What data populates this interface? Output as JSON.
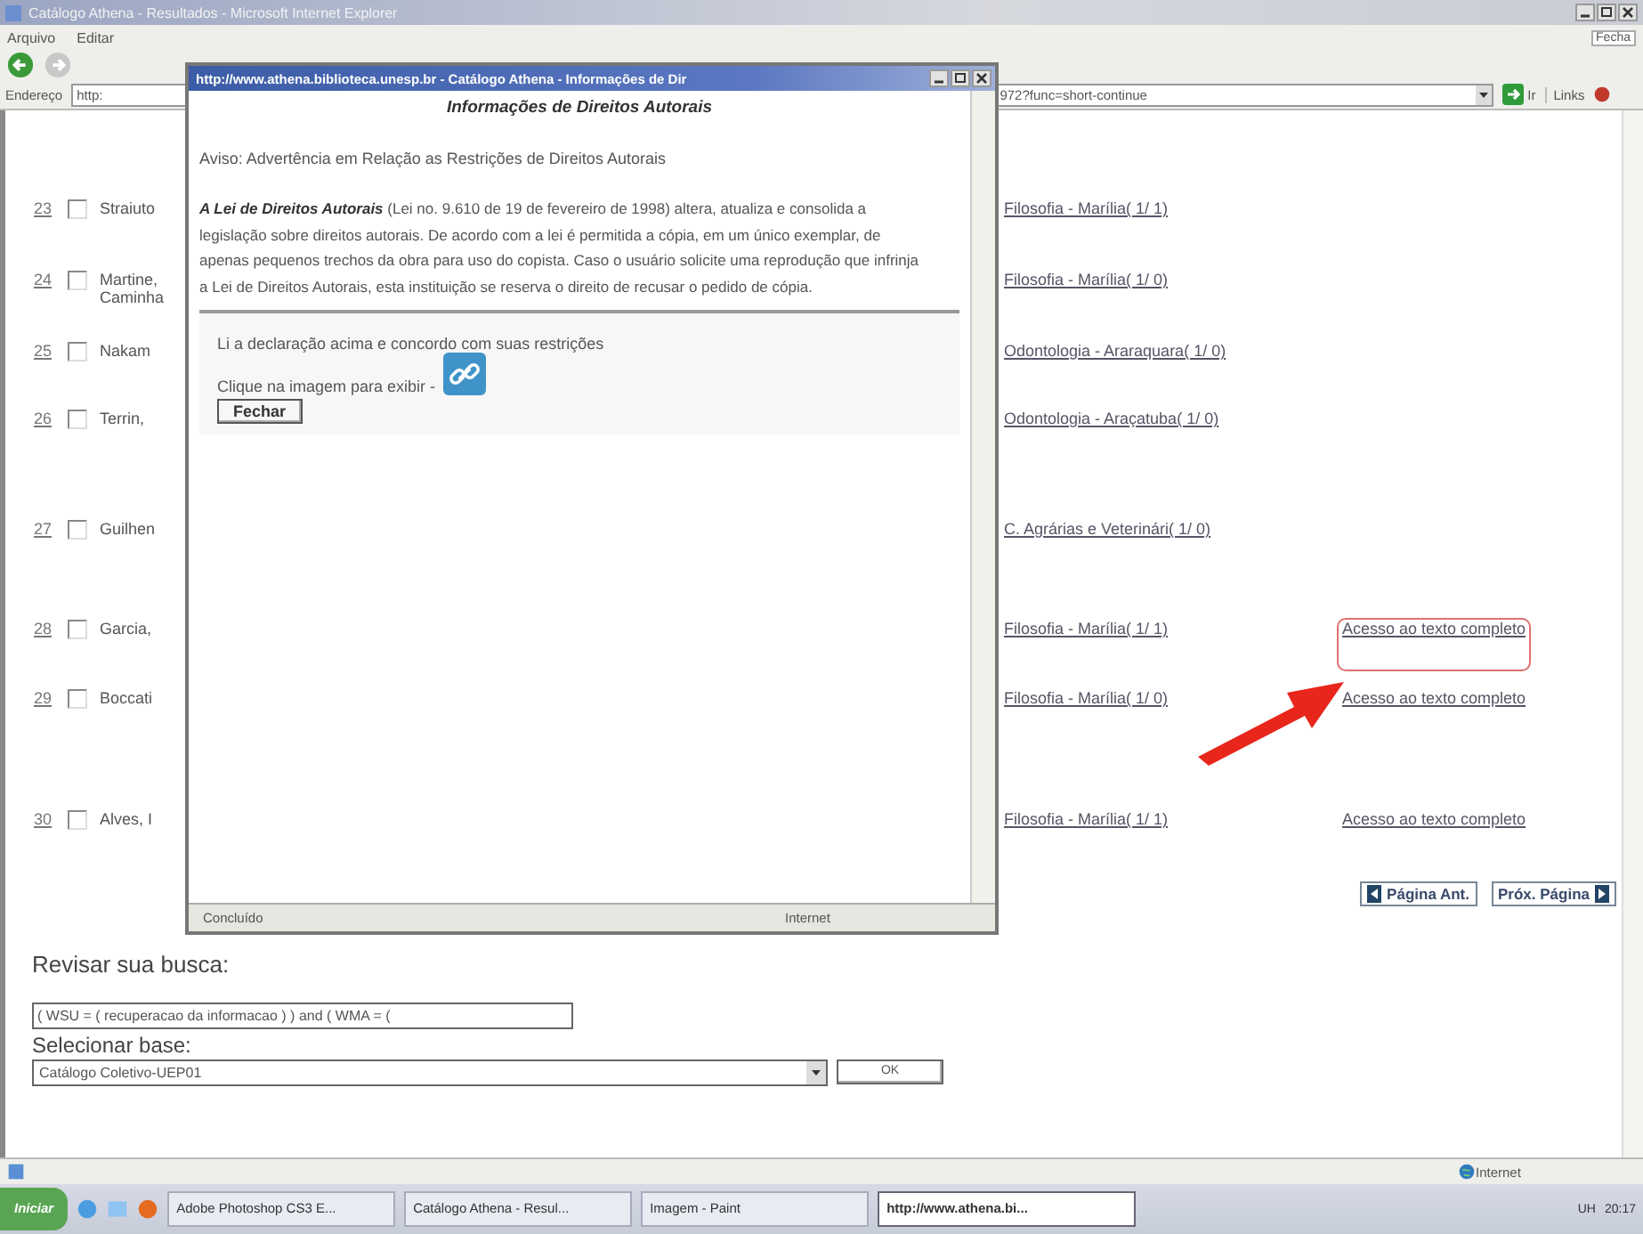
{
  "window": {
    "title": "Catálogo Athena - Resultados - Microsoft Internet Explorer",
    "close_tab": "Fecha"
  },
  "menu": [
    "Arquivo",
    "Editar"
  ],
  "address_bar": {
    "label": "Endereço",
    "prefix": "http:",
    "url": "972?func=short-continue",
    "go": "Ir",
    "links": "Links"
  },
  "results": [
    {
      "number": "23",
      "checked": false,
      "author": [
        "Straiuto"
      ],
      "location": "Filosofia - Marília( 1/ 1)"
    },
    {
      "number": "24",
      "checked": false,
      "author": [
        "Martine,",
        "Caminha"
      ],
      "location": "Filosofia - Marília( 1/ 0)"
    },
    {
      "number": "25",
      "checked": false,
      "author": [
        "Nakam"
      ],
      "location": "Odontologia - Araraquara( 1/ 0)"
    },
    {
      "number": "26",
      "checked": false,
      "author": [
        "Terrin,"
      ],
      "location": "Odontologia - Araçatuba( 1/ 0)"
    },
    {
      "number": "27",
      "checked": false,
      "author": [
        "Guilhen"
      ],
      "location": "C. Agrárias e Veterinári( 1/ 0)"
    },
    {
      "number": "28",
      "checked": false,
      "author": [
        "Garcia,"
      ],
      "location": "Filosofia - Marília( 1/ 1)",
      "full_text": {
        "label": "Acesso ao texto completo",
        "highlighted": true
      }
    },
    {
      "number": "29",
      "checked": false,
      "author": [
        "Boccati"
      ],
      "location": "Filosofia - Marília( 1/ 0)",
      "full_text": {
        "label": "Acesso ao texto completo",
        "highlighted": false
      }
    },
    {
      "number": "30",
      "checked": false,
      "author": [
        "Alves, I"
      ],
      "location": "Filosofia - Marília( 1/ 1)",
      "full_text": {
        "label": "Acesso ao texto completo",
        "highlighted": false
      }
    }
  ],
  "pager": {
    "previous": "Página Ant.",
    "next": "Próx. Página"
  },
  "search": {
    "label": "Revisar sua busca:",
    "value": "( WSU = ( recuperacao da informacao ) ) and ( WMA = ("
  },
  "base": {
    "label": "Selecionar base:",
    "value": "Catálogo Coletivo-UEP01",
    "ok": "OK"
  },
  "status_bar": {
    "zone": "Internet"
  },
  "popup": {
    "title": "http://www.athena.biblioteca.unesp.br - Catálogo Athena - Informações de Dir",
    "heading": "Informações de Direitos Autorais",
    "notice": "Aviso: Advertência em Relação as Restrições de Direitos Autorais",
    "body": "**A Lei de Direitos Autorais** (Lei no. 9.610 de 19 de fevereiro de 1998) altera, atualiza e consolida a legislação sobre direitos autorais. De acordo com a lei é permitida a cópia, em um único exemplar, de apenas pequenos trechos da obra para uso do copista. Caso o usuário solicite uma reprodução que infrinja a Lei de Direitos Autorais, esta instituição se reserva o direito de recusar o pedido de cópia.",
    "agreement": "Li a declaração acima e concordo com suas restrições",
    "click_prompt": "Clique na imagem para exibir -",
    "close_button": "Fechar",
    "status": "Concluído",
    "zone": "Internet"
  },
  "taskbar": {
    "start": "Iniciar",
    "tasks": [
      {
        "label": "Adobe Photoshop CS3 E...",
        "selected": false
      },
      {
        "label": "Catálogo Athena - Resul...",
        "selected": false
      },
      {
        "label": "Imagem - Paint",
        "selected": false
      },
      {
        "label": "http://www.athena.bi...",
        "selected": true
      }
    ],
    "tray": "UH",
    "clock": "20:17"
  }
}
